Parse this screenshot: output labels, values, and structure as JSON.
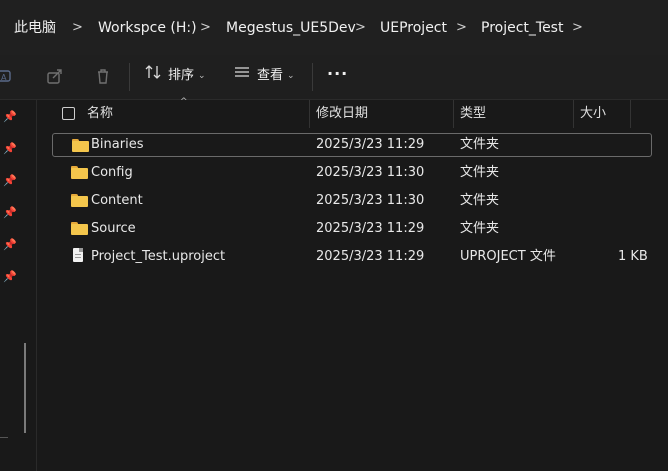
{
  "breadcrumb": {
    "items": [
      "此电脑",
      "Workspce (H:)",
      "Megestus_UE5Dev",
      "UEProject",
      "Project_Test"
    ],
    "separator": ">"
  },
  "toolbar": {
    "sort_label": "排序",
    "view_label": "查看",
    "more_label": "···"
  },
  "columns": {
    "name": "名称",
    "modified": "修改日期",
    "type": "类型",
    "size": "大小"
  },
  "files": [
    {
      "name": "Binaries",
      "modified": "2025/3/23 11:29",
      "type": "文件夹",
      "size": "",
      "kind": "folder",
      "selected": true
    },
    {
      "name": "Config",
      "modified": "2025/3/23 11:30",
      "type": "文件夹",
      "size": "",
      "kind": "folder"
    },
    {
      "name": "Content",
      "modified": "2025/3/23 11:30",
      "type": "文件夹",
      "size": "",
      "kind": "folder"
    },
    {
      "name": "Source",
      "modified": "2025/3/23 11:29",
      "type": "文件夹",
      "size": "",
      "kind": "folder"
    },
    {
      "name": "Project_Test.uproject",
      "modified": "2025/3/23 11:29",
      "type": "UPROJECT 文件",
      "size": "1 KB",
      "kind": "file"
    }
  ],
  "colors": {
    "background": "#191919",
    "folder": "#f4c64c",
    "text": "#e8e8e8"
  }
}
